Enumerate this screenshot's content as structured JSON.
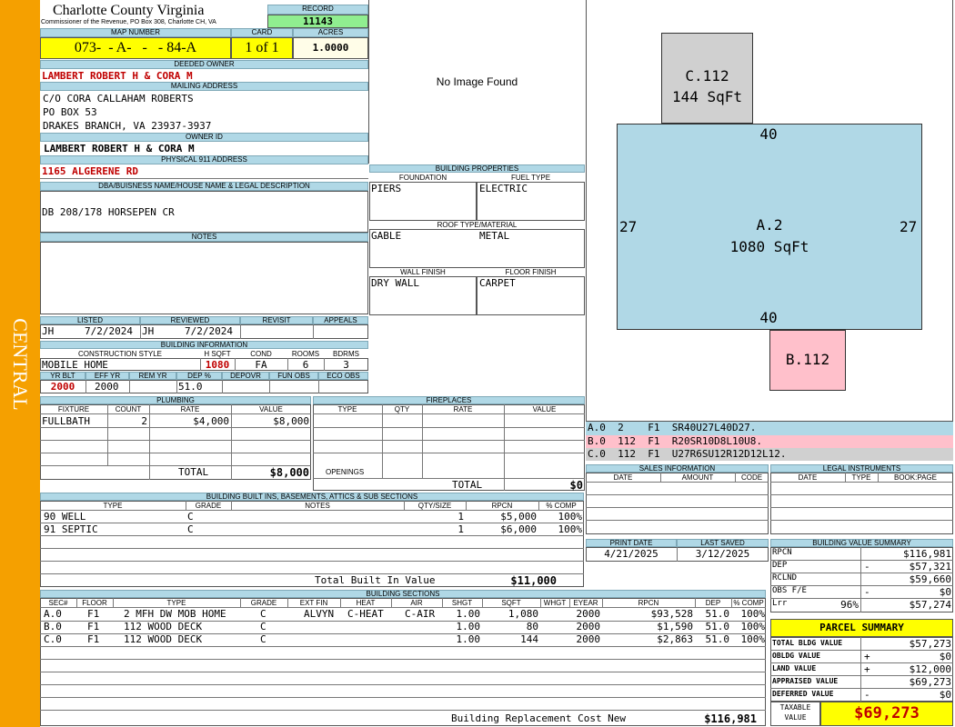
{
  "sidebar": {
    "label": "CENTRAL"
  },
  "header": {
    "county": "Charlotte County Virginia",
    "commissioner": "Commissioner of the Revenue, PO Box 308, Charlotte CH, VA"
  },
  "record": {
    "label": "RECORD",
    "value": "11143"
  },
  "map": {
    "label": "MAP NUMBER",
    "value": "073-  - A-   -   - 84-A"
  },
  "card": {
    "label": "CARD",
    "value": "1 of 1"
  },
  "acres": {
    "label": "ACRES",
    "value": "1.0000"
  },
  "deeded_owner": {
    "label": "DEEDED OWNER",
    "value": "LAMBERT ROBERT H & CORA M"
  },
  "mailing": {
    "label": "MAILING ADDRESS",
    "line1": "C/O CORA CALLAHAM ROBERTS",
    "line2": "PO BOX 53",
    "line3": "DRAKES BRANCH, VA 23937-3937"
  },
  "owner_id": {
    "label": "OWNER ID",
    "value": "LAMBERT ROBERT H & CORA M"
  },
  "physical": {
    "label": "PHYSICAL 911 ADDRESS",
    "value": "1165 ALGERENE RD"
  },
  "dba": {
    "label": "DBA/BUISNESS NAME/HOUSE NAME & LEGAL DESCRIPTION",
    "value": "DB 208/178 HORSEPEN CR"
  },
  "notes": {
    "label": "NOTES"
  },
  "image": {
    "text": "No Image Found"
  },
  "building_properties": {
    "label": "BUILDING PROPERTIES",
    "foundation_label": "FOUNDATION",
    "foundation": "PIERS",
    "fuel_label": "FUEL TYPE",
    "fuel": "ELECTRIC",
    "roof_label": "ROOF TYPE/MATERIAL",
    "roof_type": "GABLE",
    "roof_material": "METAL",
    "wall_label": "WALL FINISH",
    "wall": "DRY WALL",
    "floor_label": "FLOOR FINISH",
    "floor": "CARPET"
  },
  "sketch": {
    "c_label": "C.112",
    "c_area": "144 SqFt",
    "a_label": "A.2",
    "a_area": "1080 SqFt",
    "b_label": "B.112",
    "dim_top": "40",
    "dim_bottom": "40",
    "dim_left": "27",
    "dim_right": "27",
    "codes": [
      {
        "text": "A.0  2    F1  SR40U27L40D27.",
        "color": "#b0d8e6"
      },
      {
        "text": "B.0  112  F1  R20SR10D8L10U8.",
        "color": "#ffc0cb"
      },
      {
        "text": "C.0  112  F1  U27R6SU12R12D12L12.",
        "color": "#d0d0d0"
      }
    ]
  },
  "listed": {
    "label": "LISTED",
    "by": "JH",
    "date": "7/2/2024"
  },
  "reviewed": {
    "label": "REVIEWED",
    "by": "JH",
    "date": "7/2/2024"
  },
  "revisit": {
    "label": "REVISIT"
  },
  "appeals": {
    "label": "APPEALS"
  },
  "building_info": {
    "label": "BUILDING INFORMATION",
    "style_label": "CONSTRUCTION STYLE",
    "style": "MOBILE HOME",
    "hsqft_label": "H SQFT",
    "hsqft": "1080",
    "cond_label": "COND",
    "cond": "FA",
    "rooms_label": "ROOMS",
    "rooms": "6",
    "bdrms_label": "BDRMS",
    "bdrms": "3",
    "yrblt_label": "YR BLT",
    "yrblt": "2000",
    "effyr_label": "EFF YR",
    "effyr": "2000",
    "remyr_label": "REM YR",
    "remyr": "",
    "dep_label": "DEP %",
    "dep": "51.0",
    "depovr_label": "DEPOVR",
    "funobs_label": "FUN OBS",
    "ecoobs_label": "ECO OBS"
  },
  "plumbing": {
    "label": "PLUMBING",
    "headers": [
      "FIXTURE",
      "COUNT",
      "RATE",
      "VALUE"
    ],
    "rows": [
      {
        "fixture": "FULLBATH",
        "count": "2",
        "rate": "$4,000",
        "value": "$8,000"
      }
    ],
    "total_label": "TOTAL",
    "total": "$8,000"
  },
  "fireplaces": {
    "label": "FIREPLACES",
    "headers": [
      "TYPE",
      "QTY",
      "RATE",
      "VALUE"
    ],
    "openings_label": "OPENINGS",
    "total_label": "TOTAL",
    "total": "$0"
  },
  "sales": {
    "label": "SALES INFORMATION",
    "headers": [
      "DATE",
      "AMOUNT",
      "CODE"
    ]
  },
  "legal": {
    "label": "LEGAL INSTRUMENTS",
    "headers": [
      "DATE",
      "TYPE",
      "BOOK:PAGE"
    ]
  },
  "print": {
    "label": "PRINT DATE",
    "value": "4/21/2025"
  },
  "saved": {
    "label": "LAST SAVED",
    "value": "3/12/2025"
  },
  "builtins": {
    "label": "BUILDING BUILT INS, BASEMENTS, ATTICS & SUB SECTIONS",
    "headers": [
      "TYPE",
      "GRADE",
      "NOTES",
      "QTY/SIZE",
      "RPCN",
      "% COMP"
    ],
    "rows": [
      {
        "type": "90 WELL",
        "grade": "C",
        "notes": "",
        "qty": "1",
        "rpcn": "$5,000",
        "comp": "100%"
      },
      {
        "type": "91 SEPTIC",
        "grade": "C",
        "notes": "",
        "qty": "1",
        "rpcn": "$6,000",
        "comp": "100%"
      }
    ],
    "total_label": "Total Built In Value",
    "total": "$11,000"
  },
  "value_summary": {
    "label": "BUILDING VALUE SUMMARY",
    "rows": [
      {
        "label": "RPCN",
        "sign": "",
        "pct": "",
        "value": "$116,981"
      },
      {
        "label": "DEP",
        "sign": "-",
        "pct": "",
        "value": "$57,321"
      },
      {
        "label": "RCLND",
        "sign": "",
        "pct": "",
        "value": "$59,660"
      },
      {
        "label": "OBS F/E",
        "sign": "-",
        "pct": "",
        "value": "$0"
      },
      {
        "label": "Lrr",
        "sign": "",
        "pct": "96%",
        "value": "$57,274"
      }
    ]
  },
  "parcel": {
    "label": "PARCEL SUMMARY",
    "rows": [
      {
        "label": "TOTAL BLDG VALUE",
        "sign": "",
        "value": "$57,273"
      },
      {
        "label": "OBLDG VALUE",
        "sign": "+",
        "value": "$0"
      },
      {
        "label": "LAND VALUE",
        "sign": "+",
        "value": "$12,000"
      },
      {
        "label": "APPRAISED VALUE",
        "sign": "",
        "value": "$69,273"
      },
      {
        "label": "DEFERRED VALUE",
        "sign": "-",
        "value": "$0"
      }
    ],
    "taxable_label1": "TAXABLE",
    "taxable_label2": "VALUE",
    "taxable": "$69,273"
  },
  "sections": {
    "label": "BUILDING SECTIONS",
    "headers": [
      "SEC#",
      "FLOOR",
      "TYPE",
      "GRADE",
      "EXT FIN",
      "HEAT",
      "AIR",
      "SHGT",
      "SQFT",
      "WHGT",
      "EYEAR",
      "RPCN",
      "DEP",
      "% COMP"
    ],
    "rows": [
      {
        "sec": "A.0",
        "floor": "F1",
        "type": "2 MFH DW MOB HOME",
        "grade": "C",
        "ext": "ALVYN",
        "heat": "C-HEAT",
        "air": "C-AIR",
        "shgt": "1.00",
        "sqft": "1,080",
        "whgt": "",
        "eyear": "2000",
        "rpcn": "$93,528",
        "dep": "51.0",
        "comp": "100%"
      },
      {
        "sec": "B.0",
        "floor": "F1",
        "type": "112 WOOD DECK",
        "grade": "C",
        "ext": "",
        "heat": "",
        "air": "",
        "shgt": "1.00",
        "sqft": "80",
        "whgt": "",
        "eyear": "2000",
        "rpcn": "$1,590",
        "dep": "51.0",
        "comp": "100%"
      },
      {
        "sec": "C.0",
        "floor": "F1",
        "type": "112 WOOD DECK",
        "grade": "C",
        "ext": "",
        "heat": "",
        "air": "",
        "shgt": "1.00",
        "sqft": "144",
        "whgt": "",
        "eyear": "2000",
        "rpcn": "$2,863",
        "dep": "51.0",
        "comp": "100%"
      }
    ],
    "total_label": "Building Replacement Cost New",
    "total": "$116,981"
  }
}
